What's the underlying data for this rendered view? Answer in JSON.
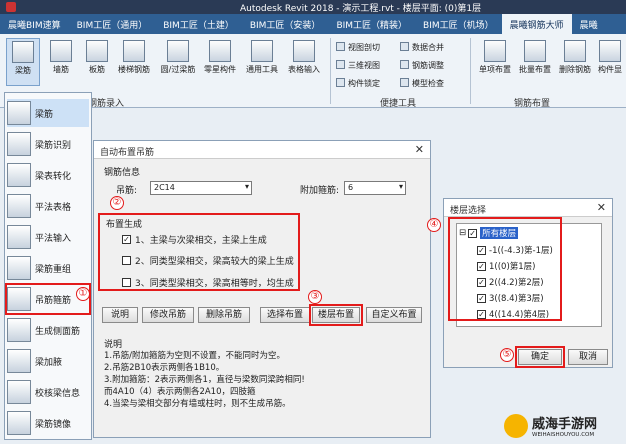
{
  "title_bar": {
    "text": "Autodesk Revit 2018 -   演示工程.rvt - 楼层平面: (0)第1层"
  },
  "ribbon_tabs": [
    "晨曦BIM速算",
    "BIM工匠（通用）",
    "BIM工匠（土建）",
    "BIM工匠（安装）",
    "BIM工匠（精装）",
    "BIM工匠（机场）",
    "晨曦钢筋大师",
    "晨曦"
  ],
  "ribbon": {
    "buttons": [
      "梁筋",
      "墙筋",
      "板筋",
      "楼梯钢筋",
      "圆/过梁筋",
      "零星构件",
      "通用工具",
      "表格输入"
    ],
    "convenience_items": [
      "视图剖切",
      "三维视图",
      "构件锁定",
      "数据合并",
      "钢筋调整",
      "模型检查"
    ],
    "right_buttons": [
      "单项布置",
      "批量布置",
      "删除钢筋",
      "构件显"
    ],
    "group_labels": [
      "钢筋录入",
      "便捷工具",
      "钢筋布置"
    ]
  },
  "left_menu": [
    "梁筋",
    "梁筋识别",
    "梁表转化",
    "平法表格",
    "平法输入",
    "梁筋重组",
    "吊筋箍筋",
    "生成侧面筋",
    "梁加腋",
    "校核梁信息",
    "梁筋镜像"
  ],
  "dialog": {
    "title": "自动布置吊筋",
    "section_rebar": "钢筋信息",
    "hanger_label": "吊筋:",
    "hanger_value": "2C14",
    "stirrup_label": "附加箍筋:",
    "stirrup_value": "6",
    "section_gen": "布置生成",
    "options": [
      {
        "text": "1、主梁与次梁相交，主梁上生成",
        "checked": true
      },
      {
        "text": "2、同类型梁相交，梁高较大的梁上生成",
        "checked": false
      },
      {
        "text": "3、同类型梁相交，梁高相等时，均生成",
        "checked": false
      }
    ],
    "buttons": [
      "说明",
      "修改吊筋",
      "删除吊筋",
      "选择布置",
      "楼层布置",
      "自定义布置"
    ],
    "notes_title": "说明",
    "notes": [
      "1.吊筋/附加箍筋为空则不设置，不能同时为空。",
      "2.吊筋2B10表示两侧各1B10。",
      "3.附加箍筋：2表示两侧各1，直径与梁数同梁跨相同!",
      "  而4A10（4）表示两侧各2A10，四肢箍",
      "4.当梁与梁相交部分有墙或柱时，则不生成吊筋。"
    ]
  },
  "floor_dialog": {
    "title": "楼层选择",
    "root": "所有楼层",
    "floors": [
      "-1((-4.3)第-1层)",
      "1((0)第1层)",
      "2((4.2)第2层)",
      "3((8.4)第3层)",
      "4((14.4)第4层)"
    ],
    "ok": "确定",
    "cancel": "取消"
  },
  "markers": [
    "①",
    "②",
    "③",
    "④",
    "⑤"
  ],
  "watermark": {
    "name": "威海手游网",
    "url": "WEIHAISHOUYOU.COM"
  }
}
